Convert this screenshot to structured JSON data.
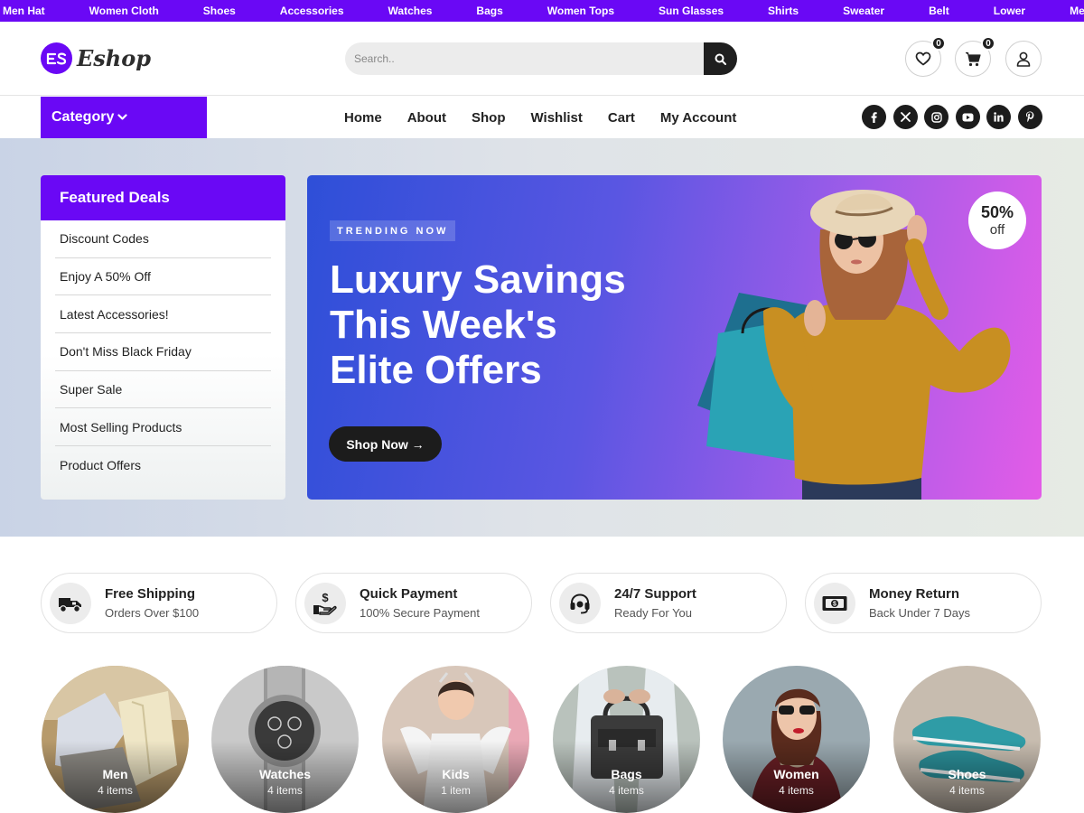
{
  "topbar": {
    "items": [
      "Men Hat",
      "Women Cloth",
      "Shoes",
      "Accessories",
      "Watches",
      "Bags",
      "Women Tops",
      "Sun Glasses",
      "Shirts",
      "Sweater",
      "Belt",
      "Lower",
      "Men Hat"
    ]
  },
  "header": {
    "logo_text": "Eshop",
    "search_placeholder": "Search..",
    "wishlist_count": "0",
    "cart_count": "0"
  },
  "nav": {
    "category_label": "Category",
    "links": [
      "Home",
      "About",
      "Shop",
      "Wishlist",
      "Cart",
      "My Account"
    ],
    "socials": [
      "facebook-icon",
      "x-icon",
      "instagram-icon",
      "youtube-icon",
      "linkedin-icon",
      "pinterest-icon"
    ]
  },
  "deals": {
    "title": "Featured Deals",
    "items": [
      "Discount Codes",
      "Enjoy A 50% Off",
      "Latest Accessories!",
      "Don't Miss Black Friday",
      "Super Sale",
      "Most Selling Products",
      "Product Offers"
    ]
  },
  "banner": {
    "tag": "TRENDING NOW",
    "title_lines": [
      "Luxury Savings",
      "This Week's",
      "Elite Offers"
    ],
    "cta": "Shop Now →",
    "discount_pct": "50%",
    "discount_off": "off"
  },
  "features": [
    {
      "title": "Free Shipping",
      "sub": "Orders Over $100",
      "icon": "truck-icon"
    },
    {
      "title": "Quick Payment",
      "sub": "100% Secure Payment",
      "icon": "payment-icon"
    },
    {
      "title": "24/7 Support",
      "sub": "Ready For You",
      "icon": "headset-icon"
    },
    {
      "title": "Money Return",
      "sub": "Back Under 7 Days",
      "icon": "money-icon"
    }
  ],
  "categories": [
    {
      "name": "Men",
      "count": "4 items"
    },
    {
      "name": "Watches",
      "count": "4 items"
    },
    {
      "name": "Kids",
      "count": "1 item"
    },
    {
      "name": "Bags",
      "count": "4 items"
    },
    {
      "name": "Women",
      "count": "4 items"
    },
    {
      "name": "Shoes",
      "count": "4 items"
    }
  ],
  "colors": {
    "brand": "#6a08f5",
    "dark": "#1c1c1c"
  }
}
